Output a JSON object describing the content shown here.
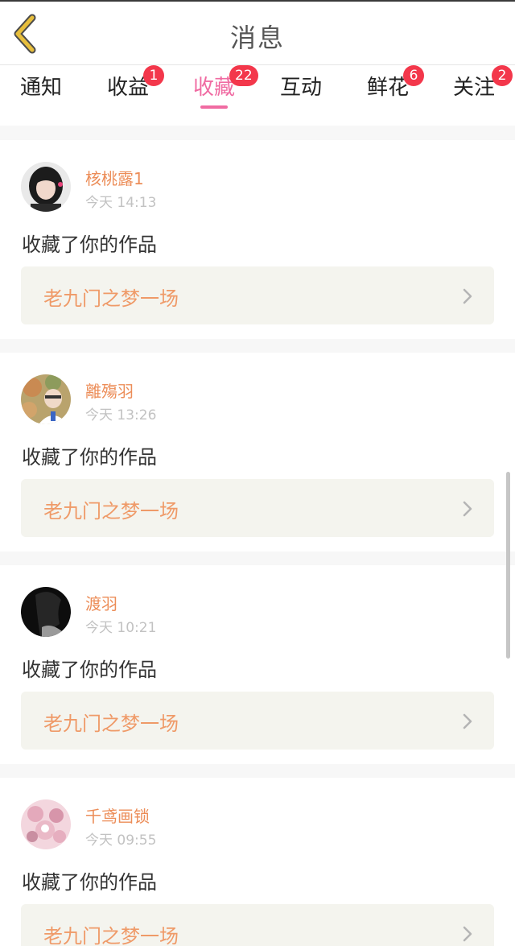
{
  "header": {
    "title": "消息",
    "back_icon": "chevron-left-icon",
    "back_icon_color": "#e7be3c"
  },
  "tabs": [
    {
      "label": "通知",
      "badge": null,
      "active": false
    },
    {
      "label": "收益",
      "badge": "1",
      "active": false
    },
    {
      "label": "收藏",
      "badge": "22",
      "active": true
    },
    {
      "label": "互动",
      "badge": null,
      "active": false
    },
    {
      "label": "鲜花",
      "badge": "6",
      "active": false
    },
    {
      "label": "关注",
      "badge": "2",
      "active": false
    }
  ],
  "colors": {
    "accent": "#f06ba2",
    "badge": "#f3374b",
    "username": "#ec8d58",
    "work_title": "#ef9a68",
    "work_bg": "#f4f4ee"
  },
  "notifications": [
    {
      "username": "核桃露1",
      "time": "今天 14:13",
      "action": "收藏了你的作品",
      "work_title": "老九门之梦一场"
    },
    {
      "username": "離殤羽",
      "time": "今天 13:26",
      "action": "收藏了你的作品",
      "work_title": "老九门之梦一场"
    },
    {
      "username": "渡羽",
      "time": "今天 10:21",
      "action": "收藏了你的作品",
      "work_title": "老九门之梦一场"
    },
    {
      "username": "千鸢画锁",
      "time": "今天 09:55",
      "action": "收藏了你的作品",
      "work_title": "老九门之梦一场"
    }
  ]
}
